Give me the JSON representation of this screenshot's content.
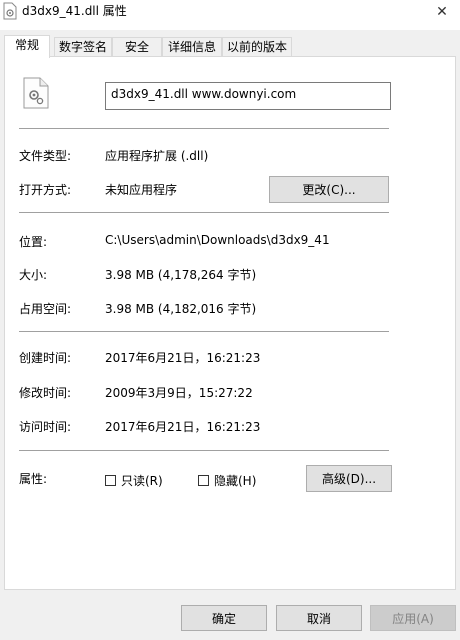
{
  "window": {
    "title": "d3dx9_41.dll 属性",
    "close_glyph": "✕"
  },
  "tabs": [
    {
      "label": "常规",
      "active": true
    },
    {
      "label": "数字签名",
      "active": false
    },
    {
      "label": "安全",
      "active": false
    },
    {
      "label": "详细信息",
      "active": false
    },
    {
      "label": "以前的版本",
      "active": false
    }
  ],
  "general": {
    "file_name": "d3dx9_41.dll     www.downyi.com",
    "file_type_label": "文件类型:",
    "file_type_value": "应用程序扩展 (.dll)",
    "opens_with_label": "打开方式:",
    "opens_with_value": "未知应用程序",
    "change_button": "更改(C)...",
    "location_label": "位置:",
    "location_value": "C:\\Users\\admin\\Downloads\\d3dx9_41",
    "size_label": "大小:",
    "size_value": "3.98 MB (4,178,264 字节)",
    "size_on_disk_label": "占用空间:",
    "size_on_disk_value": "3.98 MB (4,182,016 字节)",
    "created_label": "创建时间:",
    "created_value": "2017年6月21日，16:21:23",
    "modified_label": "修改时间:",
    "modified_value": "2009年3月9日，15:27:22",
    "accessed_label": "访问时间:",
    "accessed_value": "2017年6月21日，16:21:23",
    "attributes_label": "属性:",
    "readonly_label": "只读(R)",
    "hidden_label": "隐藏(H)",
    "advanced_button": "高级(D)..."
  },
  "footer": {
    "ok": "确定",
    "cancel": "取消",
    "apply": "应用(A)"
  }
}
